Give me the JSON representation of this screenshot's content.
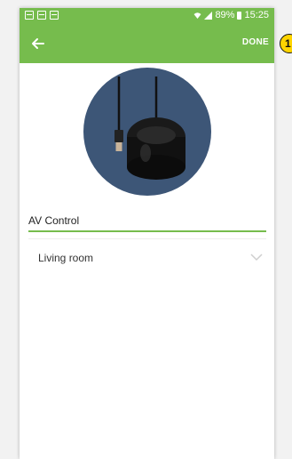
{
  "status_bar": {
    "battery": "89%",
    "time": "15:25",
    "left_icons": [
      "image-icon",
      "cast-icon",
      "gallery-icon"
    ]
  },
  "toolbar": {
    "done_label": "DONE"
  },
  "device": {
    "name": "AV Control",
    "image": "ir-blaster-device-image"
  },
  "room_select": {
    "selected": "Living room"
  },
  "callout": {
    "number": "1"
  },
  "colors": {
    "accent": "#76bc4d",
    "hero_bg": "#3d5677",
    "callout": "#ffd400"
  }
}
